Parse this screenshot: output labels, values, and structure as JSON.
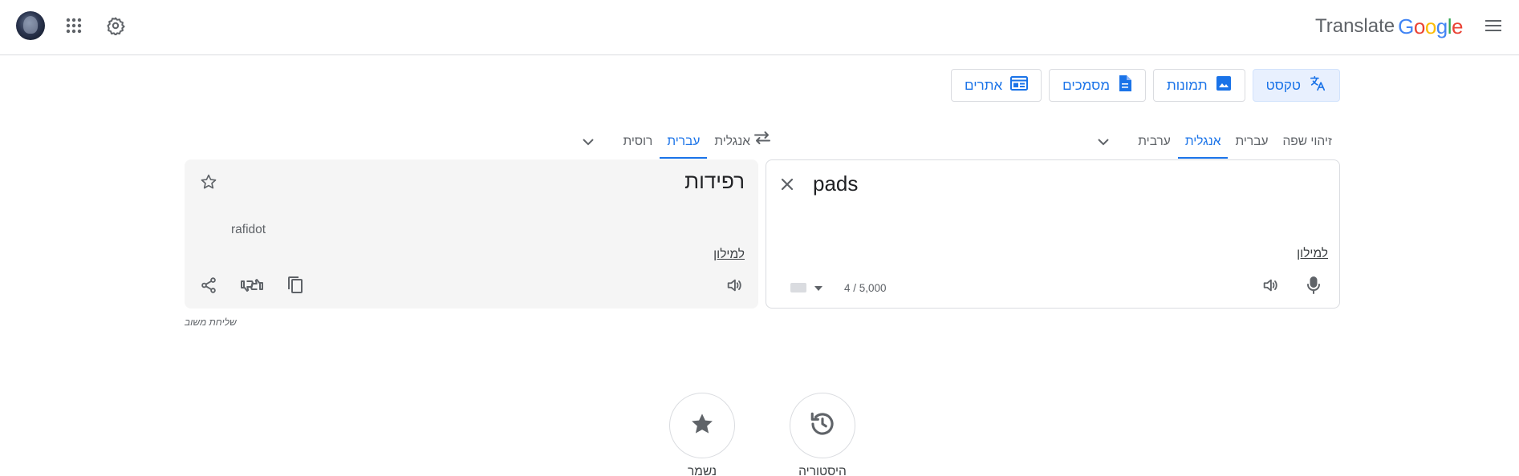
{
  "header": {
    "brand_word": "Translate",
    "brand_letters": [
      {
        "ch": "G",
        "color": "#4285f4"
      },
      {
        "ch": "o",
        "color": "#ea4335"
      },
      {
        "ch": "o",
        "color": "#fbbc05"
      },
      {
        "ch": "g",
        "color": "#4285f4"
      },
      {
        "ch": "l",
        "color": "#34a853"
      },
      {
        "ch": "e",
        "color": "#ea4335"
      }
    ],
    "icons": [
      "menu-icon",
      "settings-icon",
      "apps-icon",
      "avatar"
    ]
  },
  "modes": [
    {
      "label": "טקסט",
      "icon": "translate-icon",
      "active": true
    },
    {
      "label": "תמונות",
      "icon": "image-icon",
      "active": false
    },
    {
      "label": "מסמכים",
      "icon": "document-icon",
      "active": false
    },
    {
      "label": "אתרים",
      "icon": "website-icon",
      "active": false
    }
  ],
  "source_langs": {
    "tabs": [
      {
        "label": "זיהוי שפה",
        "active": false
      },
      {
        "label": "עברית",
        "active": false
      },
      {
        "label": "אנגלית",
        "active": true
      },
      {
        "label": "ערבית",
        "active": false
      }
    ]
  },
  "target_langs": {
    "tabs": [
      {
        "label": "אנגלית",
        "active": false
      },
      {
        "label": "עברית",
        "active": true
      },
      {
        "label": "רוסית",
        "active": false
      }
    ]
  },
  "source": {
    "text": "pads",
    "dict_link": "למילון",
    "char_count": "4 / 5,000"
  },
  "target": {
    "text": "רפידות",
    "transliteration": "rafidot",
    "dict_link": "למילון"
  },
  "send_feedback": "שליחת משוב",
  "bottom": {
    "history_label": "היסטוריה",
    "saved_label": "נשמר"
  },
  "colors": {
    "accent": "#1a73e8",
    "active_bg": "#e8f0fe",
    "icon_gray": "#5f6368",
    "border": "#dadce0"
  }
}
